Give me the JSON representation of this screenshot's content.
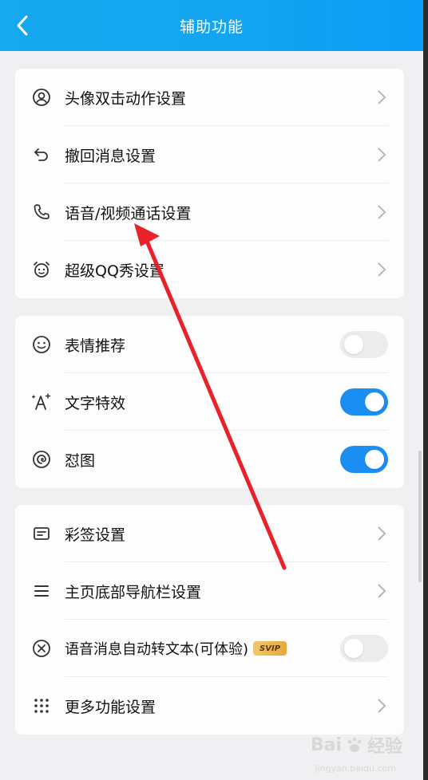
{
  "header": {
    "title": "辅助功能"
  },
  "groups": [
    {
      "items": [
        {
          "label": "头像双击动作设置",
          "icon": "user-circle-icon",
          "control": "chevron"
        },
        {
          "label": "撤回消息设置",
          "icon": "undo-icon",
          "control": "chevron"
        },
        {
          "label": "语音/视频通话设置",
          "icon": "phone-icon",
          "control": "chevron"
        },
        {
          "label": "超级QQ秀设置",
          "icon": "alarm-face-icon",
          "control": "chevron"
        }
      ]
    },
    {
      "items": [
        {
          "label": "表情推荐",
          "icon": "smiley-icon",
          "control": "toggle",
          "enabled": false
        },
        {
          "label": "文字特效",
          "icon": "text-effect-icon",
          "control": "toggle",
          "enabled": true
        },
        {
          "label": "怼图",
          "icon": "swirl-icon",
          "control": "toggle",
          "enabled": true
        }
      ]
    },
    {
      "items": [
        {
          "label": "彩签设置",
          "icon": "tag-card-icon",
          "control": "chevron"
        },
        {
          "label": "主页底部导航栏设置",
          "icon": "menu-lines-icon",
          "control": "chevron"
        },
        {
          "label": "语音消息自动转文本(可体验)",
          "icon": "voice-convert-icon",
          "control": "toggle",
          "enabled": false,
          "badge": "SVIP"
        },
        {
          "label": "更多功能设置",
          "icon": "grid-dots-icon",
          "control": "chevron"
        }
      ]
    }
  ],
  "watermark": {
    "brand": "Bai",
    "suffix": "经验",
    "url": "jingyan.baidu.com"
  },
  "colors": {
    "accent": "#1b8ef2",
    "header": "#12a4f0",
    "annotation_arrow": "#e8212a"
  }
}
